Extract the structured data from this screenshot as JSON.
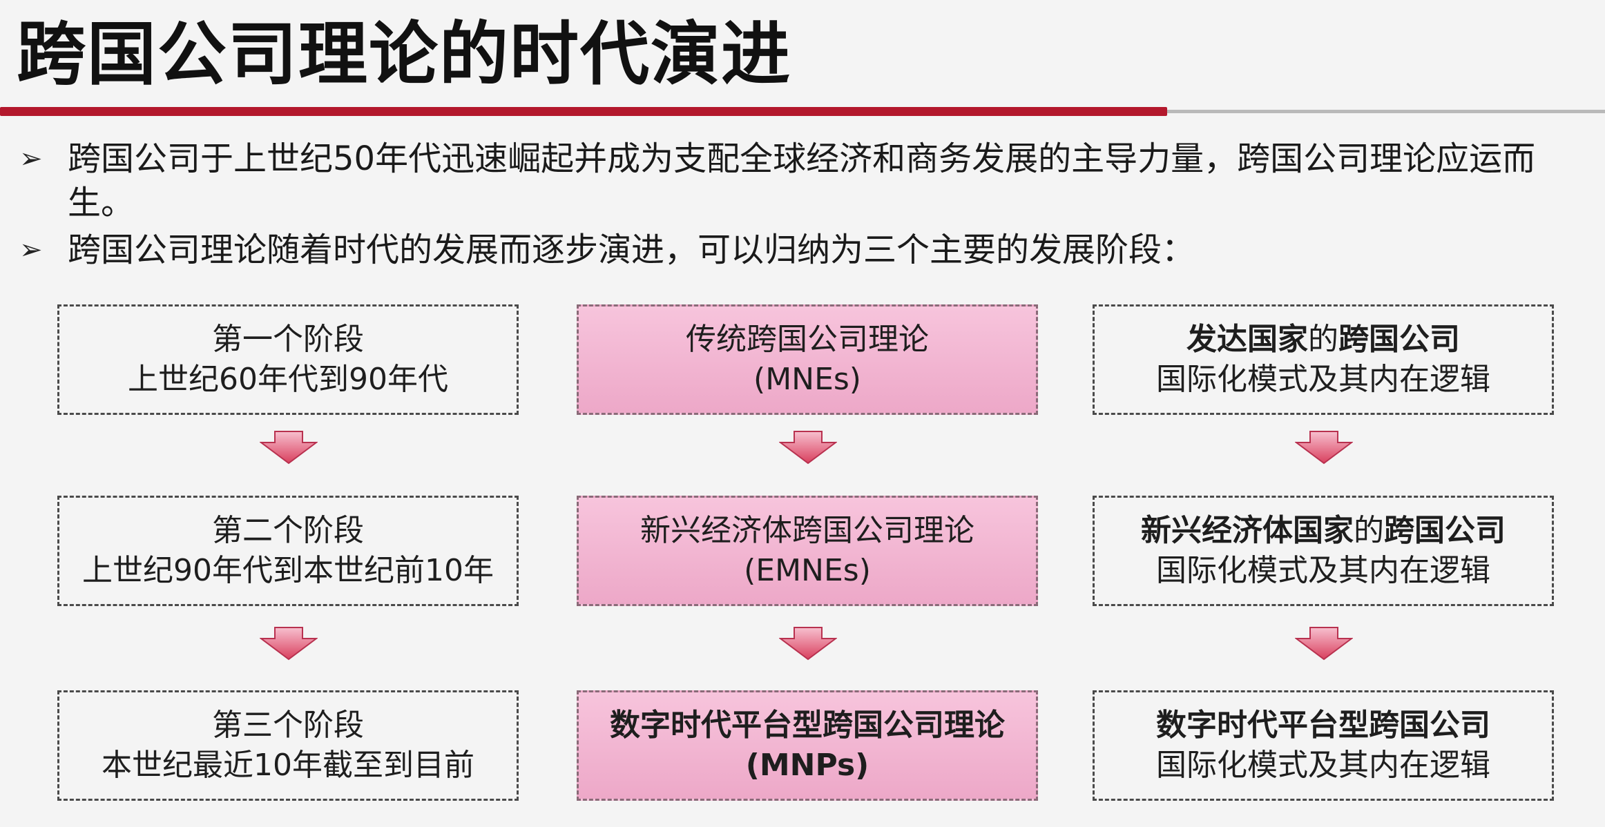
{
  "slide": {
    "title": "跨国公司理论的时代演进",
    "bullets": [
      {
        "marker": "➢",
        "text": "跨国公司于上世纪50年代迅速崛起并成为支配全球经济和商务发展的主导力量，跨国公司理论应运而生。"
      },
      {
        "marker": "➢",
        "text": "跨国公司理论随着时代的发展而逐步演进，可以归纳为三个主要的发展阶段："
      }
    ]
  },
  "stages": {
    "col1": [
      {
        "line1": "第一个阶段",
        "line2": "上世纪60年代到90年代"
      },
      {
        "line1": "第二个阶段",
        "line2": "上世纪90年代到本世纪前10年"
      },
      {
        "line1": "第三个阶段",
        "line2": "本世纪最近10年截至到目前"
      }
    ],
    "col2": [
      {
        "line1": "传统跨国公司理论",
        "line2": "(MNEs)"
      },
      {
        "line1": "新兴经济体跨国公司理论",
        "line2": "(EMNEs)"
      },
      {
        "line1": "数字时代平台型跨国公司理论",
        "line2": "(MNPs)"
      }
    ],
    "col3": [
      {
        "line1_bold_a": "发达国家",
        "line1_mid": "的",
        "line1_bold_b": "跨国公司",
        "line2": "国际化模式及其内在逻辑"
      },
      {
        "line1_bold_a": "新兴经济体国家",
        "line1_mid": "的",
        "line1_bold_b": "跨国公司",
        "line2": "国际化模式及其内在逻辑"
      },
      {
        "line1_bold_a": "数字时代平台型跨国公司",
        "line1_mid": "",
        "line1_bold_b": "",
        "line2": "国际化模式及其内在逻辑"
      }
    ]
  },
  "colors": {
    "accent_red": "#b3182c",
    "box_pink": "#f2b6d2",
    "arrow_pink": "#f2a0b8"
  },
  "icons": {
    "bullet_marker": "arrowhead-bullet-icon",
    "down_arrow": "down-arrow-icon"
  }
}
